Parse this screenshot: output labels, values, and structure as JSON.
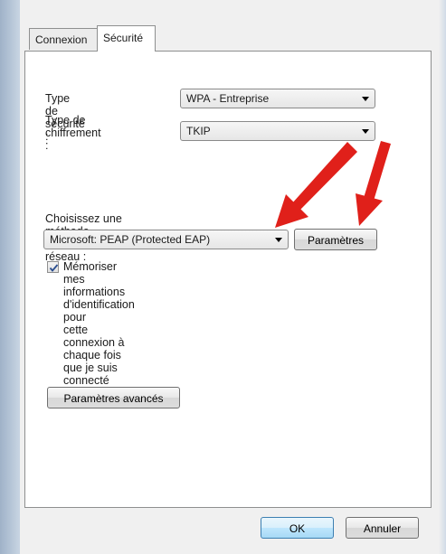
{
  "tabs": [
    {
      "label": "Connexion",
      "active": false
    },
    {
      "label": "Sécurité",
      "active": true
    }
  ],
  "security": {
    "type_label": "Type de sécurité :",
    "type_value": "WPA - Entreprise",
    "encryption_label_line1": "Type de",
    "encryption_label_line2": "chiffrement :",
    "encryption_value": "TKIP",
    "auth_method_label": "Choisissez une méthode d'authentification réseau :",
    "auth_method_value": "Microsoft: PEAP (Protected EAP)",
    "settings_button": "Paramètres",
    "remember_checked": true,
    "remember_line1": "Mémoriser mes informations d'identification pour",
    "remember_line2": "cette connexion à chaque fois que je suis connecté",
    "advanced_button": "Paramètres avancés"
  },
  "footer": {
    "ok": "OK",
    "cancel": "Annuler"
  },
  "colors": {
    "annotation_arrow": "#e0201a",
    "checkmark": "#2a4d8f"
  },
  "icons": {
    "dropdown": "chevron-down-icon",
    "check": "checkmark-icon"
  }
}
